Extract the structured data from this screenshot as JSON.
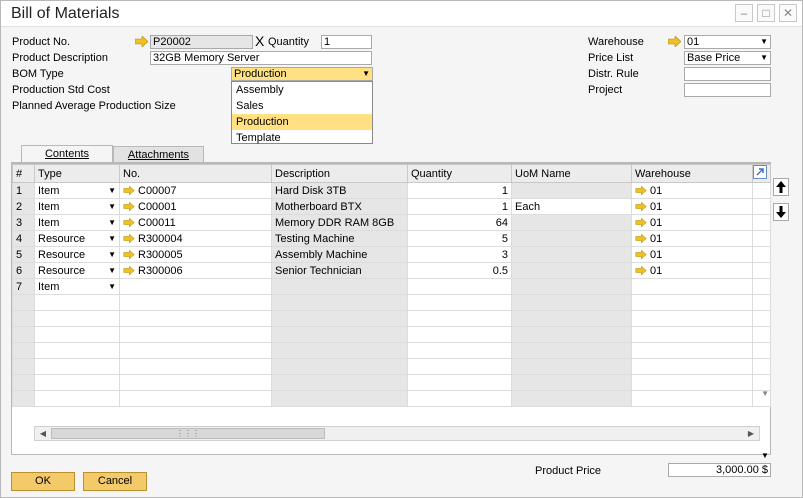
{
  "window": {
    "title": "Bill of Materials"
  },
  "header": {
    "product_no_label": "Product No.",
    "product_no": "P20002",
    "x": "X",
    "quantity_label": "Quantity",
    "quantity": "1",
    "product_description_label": "Product Description",
    "product_description": "32GB Memory Server",
    "bom_type_label": "BOM Type",
    "bom_type": "Production",
    "production_std_cost_label": "Production Std Cost",
    "planned_avg_label": "Planned Average Production Size",
    "warehouse_label": "Warehouse",
    "warehouse": "01",
    "price_list_label": "Price List",
    "price_list": "Base Price",
    "distr_rule_label": "Distr. Rule",
    "project_label": "Project"
  },
  "bom_type_options": [
    {
      "label": "Assembly",
      "selected": false
    },
    {
      "label": "Sales",
      "selected": false
    },
    {
      "label": "Production",
      "selected": true
    },
    {
      "label": "Template",
      "selected": false
    }
  ],
  "tabs": [
    {
      "label": "Contents",
      "active": true
    },
    {
      "label": "Attachments",
      "active": false
    }
  ],
  "grid": {
    "columns": [
      "#",
      "Type",
      "No.",
      "Description",
      "Quantity",
      "UoM Name",
      "Warehouse"
    ],
    "rows": [
      {
        "num": "1",
        "type": "Item",
        "no": "C00007",
        "description": "Hard Disk 3TB",
        "quantity": "1",
        "uom": "",
        "warehouse": "01"
      },
      {
        "num": "2",
        "type": "Item",
        "no": "C00001",
        "description": "Motherboard BTX",
        "quantity": "1",
        "uom": "Each",
        "warehouse": "01"
      },
      {
        "num": "3",
        "type": "Item",
        "no": "C00011",
        "description": "Memory DDR RAM 8GB",
        "quantity": "64",
        "uom": "",
        "warehouse": "01"
      },
      {
        "num": "4",
        "type": "Resource",
        "no": "R300004",
        "description": "Testing Machine",
        "quantity": "5",
        "uom": "",
        "warehouse": "01"
      },
      {
        "num": "5",
        "type": "Resource",
        "no": "R300005",
        "description": "Assembly Machine",
        "quantity": "3",
        "uom": "",
        "warehouse": "01"
      },
      {
        "num": "6",
        "type": "Resource",
        "no": "R300006",
        "description": "Senior Technician",
        "quantity": "0.5",
        "uom": "",
        "warehouse": "01"
      },
      {
        "num": "7",
        "type": "Item",
        "no": "",
        "description": "",
        "quantity": "",
        "uom": "",
        "warehouse": ""
      }
    ]
  },
  "footer": {
    "product_price_label": "Product Price",
    "product_price": "3,000.00 $",
    "ok_label": "OK",
    "cancel_label": "Cancel"
  },
  "colors": {
    "accent": "#f4c96a",
    "selected": "#ffe083",
    "link_arrow": "#f0c020"
  }
}
